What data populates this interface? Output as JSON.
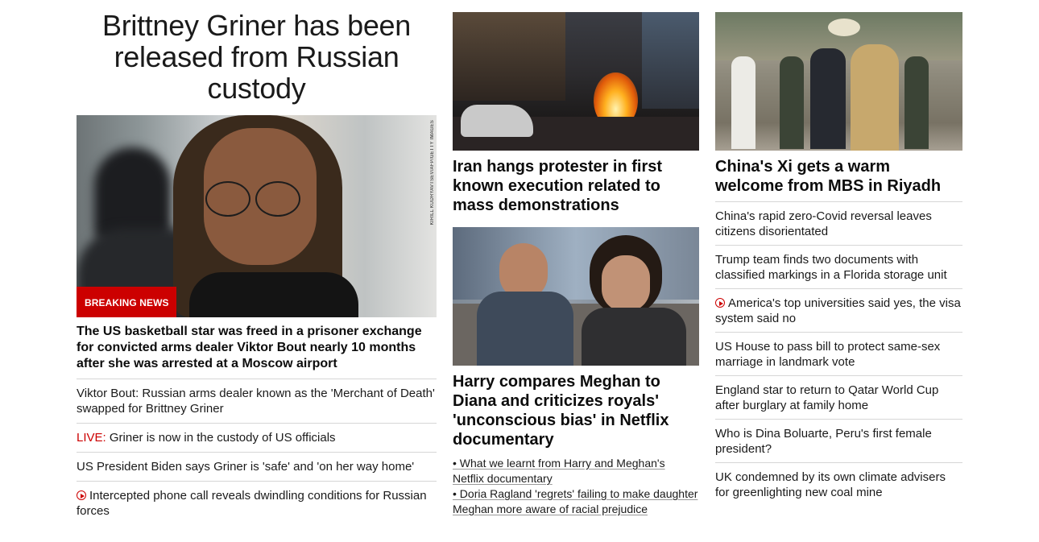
{
  "main": {
    "headline": "Brittney Griner has been released from Russian custody",
    "badge": "BREAKING NEWS",
    "image_credit": "KIRILL KUDRYAVTSEV/AFP/GETTY IMAGES",
    "subhead": "The US basketball star was freed in a prisoner exchange for convicted arms dealer Viktor Bout nearly 10 months after she was arrested at a Moscow airport",
    "related": [
      {
        "text": "Viktor Bout: Russian arms dealer known as the 'Merchant of Death' swapped for Brittney Griner"
      },
      {
        "prefix": "LIVE:",
        "text": " Griner is now in the custody of US officials"
      },
      {
        "text": "US President Biden says Griner is 'safe' and 'on her way home'"
      },
      {
        "icon": "play-icon",
        "text": "Intercepted phone call reveals dwindling conditions for Russian forces"
      }
    ]
  },
  "middle": {
    "story1": {
      "title": "Iran hangs protester in first known execution related to mass demonstrations"
    },
    "story2": {
      "title": "Harry compares Meghan to Diana and criticizes royals' 'unconscious bias' in Netflix documentary",
      "bullets": [
        "• What we learnt from Harry and Meghan's Netflix documentary",
        "• Doria Ragland 'regrets' failing to make daughter Meghan more aware of racial prejudice"
      ]
    }
  },
  "right": {
    "title": "China's Xi gets a warm welcome from MBS in Riyadh",
    "items": [
      {
        "text": "China's rapid zero-Covid reversal leaves citizens disorientated"
      },
      {
        "text": "Trump team finds two documents with classified markings in a Florida storage unit"
      },
      {
        "icon": "play-icon",
        "text": "America's top universities said yes, the visa system said no"
      },
      {
        "text": "US House to pass bill to protect same-sex marriage in landmark vote"
      },
      {
        "text": "England star to return to Qatar World Cup after burglary at family home"
      },
      {
        "text": "Who is Dina Boluarte, Peru's first female president?"
      },
      {
        "text": "UK condemned by its own climate advisers for greenlighting new coal mine"
      }
    ]
  },
  "colors": {
    "accent": "#cc0000",
    "divider": "#d6d6d6",
    "text": "#0c0c0c"
  }
}
